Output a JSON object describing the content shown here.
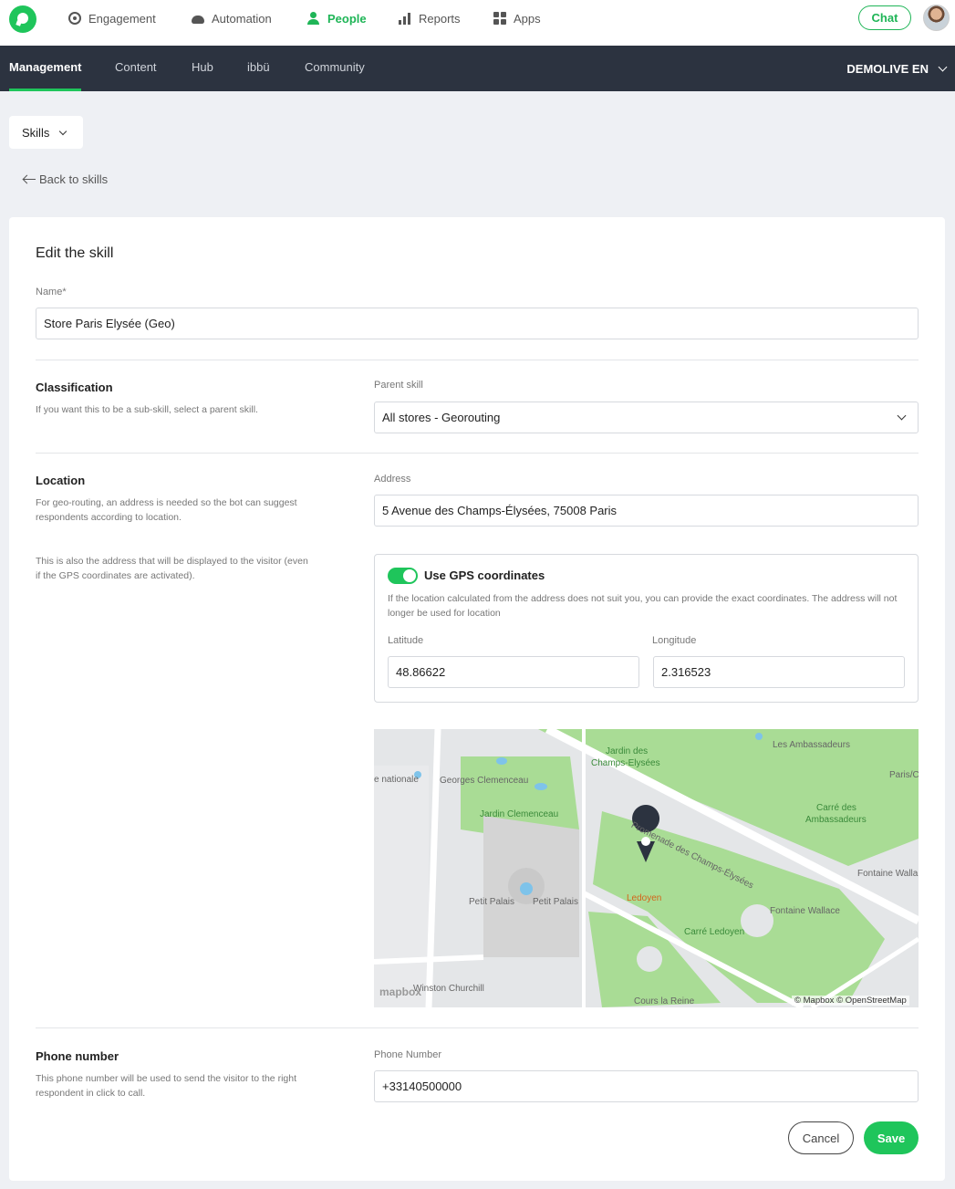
{
  "topnav": {
    "items": [
      {
        "label": "Engagement",
        "icon": "target-icon"
      },
      {
        "label": "Automation",
        "icon": "cloud-icon"
      },
      {
        "label": "People",
        "icon": "person-icon"
      },
      {
        "label": "Reports",
        "icon": "bar-chart-icon"
      },
      {
        "label": "Apps",
        "icon": "grid-icon"
      }
    ],
    "chat_label": "Chat",
    "accent": "#1fc55b"
  },
  "subnav": {
    "tabs": [
      "Management",
      "Content",
      "Hub",
      "ibbü",
      "Community"
    ],
    "workspace": "DEMOLIVE EN"
  },
  "skills_dropdown": "Skills",
  "back_link": "Back to skills",
  "form": {
    "title": "Edit the skill",
    "name_label": "Name*",
    "name_value": "Store Paris Elysée (Geo)",
    "classification": {
      "title": "Classification",
      "hint": "If you want this to be a sub-skill, select a parent skill.",
      "parent_label": "Parent skill",
      "parent_value": "All stores - Georouting"
    },
    "location": {
      "title": "Location",
      "hint1": "For geo-routing, an address is needed so the bot can suggest respondents according to location.",
      "hint2": "This is also the address that will be displayed to the visitor (even if the GPS coordinates are activated).",
      "address_label": "Address",
      "address_value": "5 Avenue des Champs-Élysées, 75008 Paris",
      "gps_toggle_label": "Use GPS coordinates",
      "gps_hint": "If the location calculated from the address does not suit you, you can provide the exact coordinates. The address will not longer be used for location",
      "latitude_label": "Latitude",
      "latitude_value": "48.86622",
      "longitude_label": "Longitude",
      "longitude_value": "2.316523"
    },
    "map": {
      "labels": {
        "jardin_ce": "Jardin des",
        "jardin_ce2": "Champs-Elysées",
        "ambassadeurs": "Les Ambassadeurs",
        "paris": "Paris/C",
        "nationale": "e nationale",
        "georges": "Georges Clemenceau",
        "jardin_clem": "Jardin Clemenceau",
        "promenade": "Promenade des Champs-Élysées",
        "carre_amb": "Carré des",
        "carre_amb2": "Ambassadeurs",
        "fontaine1": "Fontaine Walla",
        "fontaine2": "Fontaine Wallace",
        "petit1": "Petit Palais",
        "petit2": "Petit Palais",
        "ledoyen": "Ledoyen",
        "carre_led": "Carré Ledoyen",
        "churchill": "Winston Churchill",
        "cours": "Cours la Reine",
        "reine": "Cours la Reine",
        "mapbox": "mapbox",
        "copyright": "© Mapbox © OpenStreetMap"
      }
    },
    "phone": {
      "title": "Phone number",
      "hint": "This phone number will be used to send the visitor to the right respondent in click to call.",
      "label": "Phone Number",
      "value": "+33140500000"
    },
    "cancel_label": "Cancel",
    "save_label": "Save"
  }
}
